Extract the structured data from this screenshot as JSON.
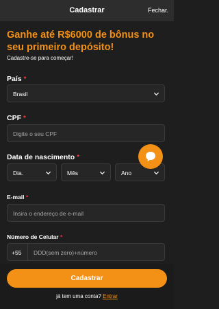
{
  "header": {
    "title": "Cadastrar",
    "close_label": "Fechar."
  },
  "promo": {
    "headline": "Ganhe até R$6000 de bônus no seu primeiro depósito!",
    "subline": "Cadastre-se para começar!"
  },
  "form": {
    "country": {
      "label": "País",
      "required_mark": "*",
      "value": "Brasil"
    },
    "cpf": {
      "label": "CPF",
      "required_mark": "*",
      "placeholder": "Digite o seu CPF"
    },
    "birthdate": {
      "label": "Data de nascimento",
      "required_mark": "*",
      "day_placeholder": "Dia.",
      "month_placeholder": "Mês",
      "year_placeholder": "Ano"
    },
    "email": {
      "label": "E-mail",
      "required_mark": "*",
      "placeholder": "Insira o endereço de e-mail"
    },
    "phone": {
      "label": "Número de Celular",
      "required_mark": "*",
      "prefix": "+55",
      "placeholder": "DDD(sem zero)+número"
    }
  },
  "actions": {
    "submit_label": "Cadastrar",
    "login_prompt": "já tem uma conta?",
    "login_link": "Entrar"
  },
  "colors": {
    "accent": "#f39016",
    "required": "#e8353c",
    "background": "#1e1e1e",
    "field_bg": "#262626"
  }
}
